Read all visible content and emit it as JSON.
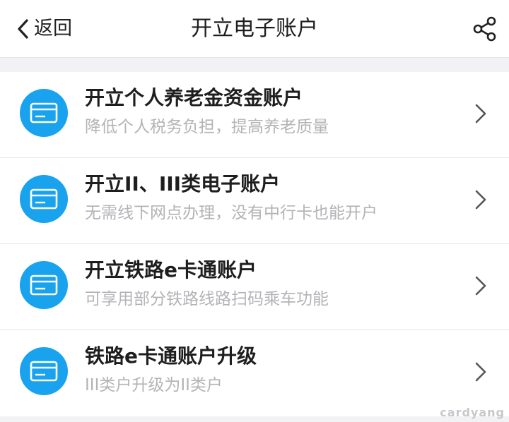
{
  "header": {
    "back_label": "返回",
    "title": "开立电子账户",
    "share_icon": "share-icon"
  },
  "items": [
    {
      "title": "开立个人养老金资金账户",
      "subtitle": "降低个人税务负担，提高养老质量",
      "icon": "card-icon"
    },
    {
      "title": "开立II、III类电子账户",
      "subtitle": "无需线下网点办理，没有中行卡也能开户",
      "icon": "card-icon"
    },
    {
      "title": "开立铁路e卡通账户",
      "subtitle": "可享用部分铁路线路扫码乘车功能",
      "icon": "card-icon"
    },
    {
      "title": "铁路e卡通账户升级",
      "subtitle": "III类户升级为II类户",
      "icon": "card-icon"
    }
  ],
  "watermark": "cardyang",
  "colors": {
    "accent": "#19a3ee",
    "title": "#1e1e1e",
    "subtitle": "#b4b4b8",
    "background": "#f2f2f4"
  }
}
